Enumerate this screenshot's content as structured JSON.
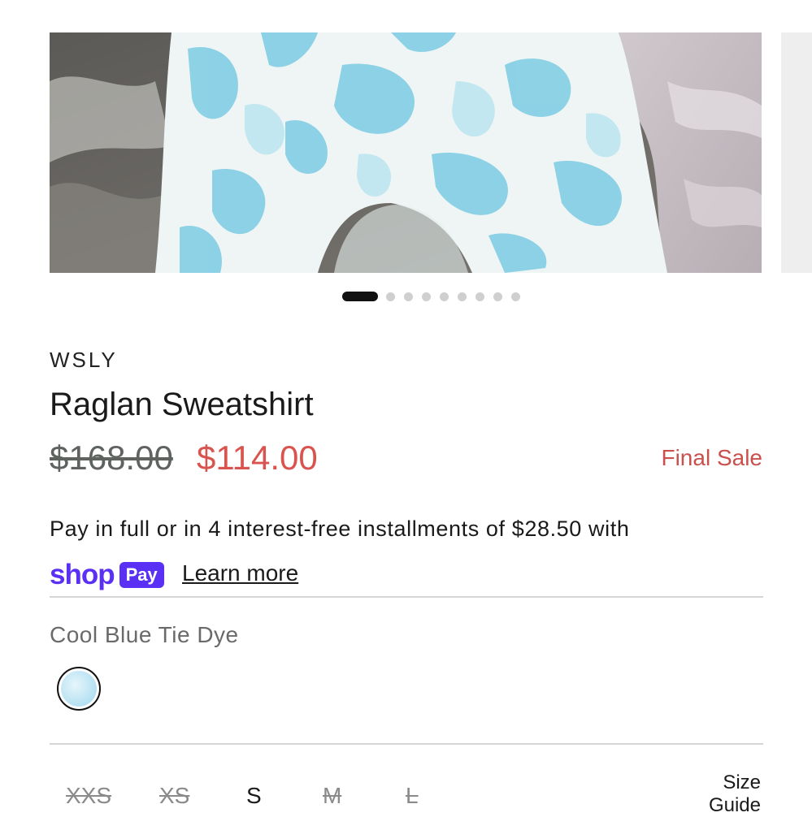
{
  "carousel": {
    "image_alt": "Cool Blue Tie Dye sweatshirt photo",
    "total_slides": 10,
    "active_slide": 1
  },
  "product": {
    "brand": "WSLY",
    "title": "Raglan Sweatshirt",
    "price_original": "$168.00",
    "price_sale": "$114.00",
    "badge": "Final Sale"
  },
  "payment": {
    "installments_text": "Pay in full or in 4 interest-free installments of $28.50 with",
    "shoppay_word": "shop",
    "shoppay_pill": "Pay",
    "learn_more": "Learn more"
  },
  "color": {
    "selected_label": "Cool Blue Tie Dye"
  },
  "sizes": [
    {
      "label": "XXS",
      "available": false
    },
    {
      "label": "XS",
      "available": false
    },
    {
      "label": "S",
      "available": true
    },
    {
      "label": "M",
      "available": false
    },
    {
      "label": "L",
      "available": false
    }
  ],
  "size_guide": {
    "line1": "Size",
    "line2": "Guide"
  },
  "colors": {
    "sale_red": "#d9544f",
    "shoppay_purple": "#5a31f4"
  }
}
